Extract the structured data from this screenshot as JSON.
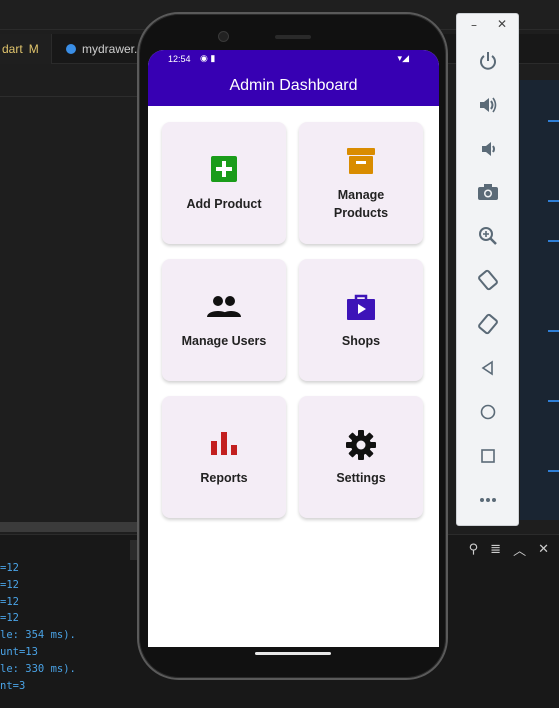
{
  "editor": {
    "tab1": "dart",
    "tab1_badge": "M",
    "tab2": "mydrawer.c",
    "console_lines": [
      "=12",
      "=12",
      "=12",
      "=12",
      "le: 354 ms).",
      "unt=13",
      "le: 330 ms).",
      "nt=3"
    ]
  },
  "phone": {
    "status_time": "12:54",
    "app_title": "Admin Dashboard",
    "cards": [
      {
        "label": "Add Product",
        "icon": "add-box-icon",
        "color": "#1a9c1a"
      },
      {
        "label": "Manage\nProducts",
        "icon": "archive-icon",
        "color": "#d98c00"
      },
      {
        "label": "Manage Users",
        "icon": "people-icon",
        "color": "#111111"
      },
      {
        "label": "Shops",
        "icon": "shop-icon",
        "color": "#3d14b8"
      },
      {
        "label": "Reports",
        "icon": "bar-chart-icon",
        "color": "#c31f1f"
      },
      {
        "label": "Settings",
        "icon": "gear-icon",
        "color": "#111111"
      }
    ]
  },
  "emulator": {
    "buttons": [
      "power-icon",
      "volume-up-icon",
      "volume-down-icon",
      "camera-icon",
      "zoom-icon",
      "rotate-left-icon",
      "rotate-right-icon",
      "back-icon",
      "home-icon",
      "overview-icon",
      "more-icon"
    ]
  },
  "colors": {
    "appbar": "#3700b3",
    "card_bg": "#f4edf6"
  }
}
